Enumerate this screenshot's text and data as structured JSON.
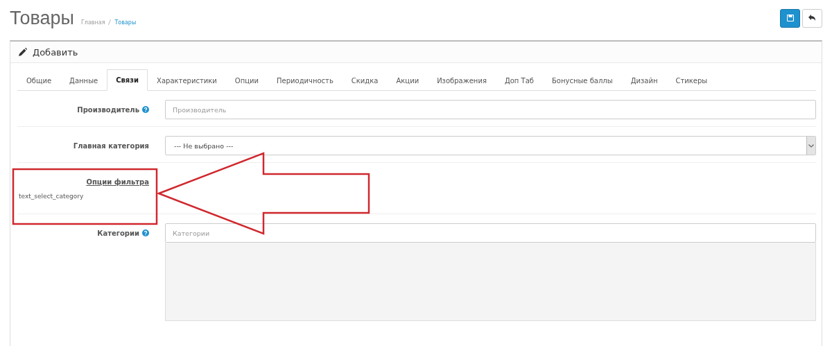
{
  "page": {
    "title": "Товары",
    "breadcrumbs": [
      {
        "label": "Главная",
        "current": false
      },
      {
        "label": "Товары",
        "current": true
      }
    ]
  },
  "toolbar": {
    "buttons": [
      {
        "kind": "save"
      },
      {
        "kind": "back"
      }
    ]
  },
  "panel": {
    "heading": "Добавить"
  },
  "tabs": [
    {
      "label": "Общие",
      "selected": false
    },
    {
      "label": "Данные",
      "selected": false
    },
    {
      "label": "Связи",
      "selected": true
    },
    {
      "label": "Характеристики",
      "selected": false
    },
    {
      "label": "Опции",
      "selected": false
    },
    {
      "label": "Периодичность",
      "selected": false
    },
    {
      "label": "Скидка",
      "selected": false
    },
    {
      "label": "Акции",
      "selected": false
    },
    {
      "label": "Изображения",
      "selected": false
    },
    {
      "label": "Доп Таб",
      "selected": false
    },
    {
      "label": "Бонусные баллы",
      "selected": false
    },
    {
      "label": "Дизайн",
      "selected": false
    },
    {
      "label": "Стикеры",
      "selected": false
    }
  ],
  "form": [
    {
      "kind": "input",
      "label": "Производитель",
      "help": true,
      "placeholder": "Производитель"
    },
    {
      "kind": "select",
      "label": "Главная категория",
      "help": false,
      "value": "--- Не выбрано ---"
    },
    {
      "kind": "note",
      "label": "Опции фильтра",
      "help": false,
      "text": "text_select_category"
    },
    {
      "kind": "list",
      "label": "Категории",
      "help": true,
      "placeholder": "Категории"
    }
  ]
}
